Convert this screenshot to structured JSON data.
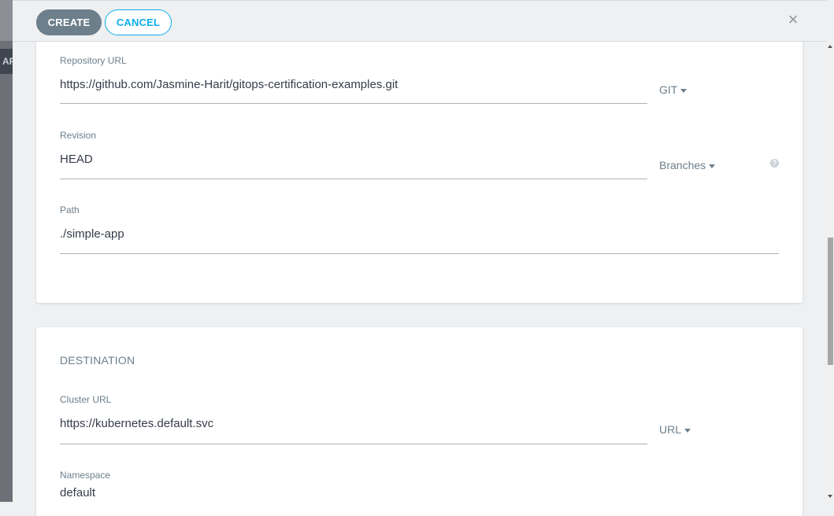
{
  "backdrop": {
    "tag_text": "AF"
  },
  "toolbar": {
    "create_label": "CREATE",
    "cancel_label": "CANCEL",
    "close_glyph": "×"
  },
  "source": {
    "repo_url": {
      "label": "Repository URL",
      "value": "https://github.com/Jasmine-Harit/gitops-certification-examples.git",
      "type": "GIT"
    },
    "revision": {
      "label": "Revision",
      "value": "HEAD",
      "type": "Branches",
      "help_glyph": "?"
    },
    "path": {
      "label": "Path",
      "value": "./simple-app"
    }
  },
  "destination": {
    "title": "DESTINATION",
    "cluster_url": {
      "label": "Cluster URL",
      "value": "https://kubernetes.default.svc",
      "type": "URL"
    },
    "namespace": {
      "label": "Namespace",
      "value": "default"
    }
  },
  "icons": {
    "close": "close-icon",
    "help": "help-icon",
    "caret": "caret-down-icon"
  },
  "colors": {
    "accent": "#0dadea",
    "create_button": "#6d7f8b",
    "label": "#6d7f8b",
    "text": "#363c4a"
  }
}
